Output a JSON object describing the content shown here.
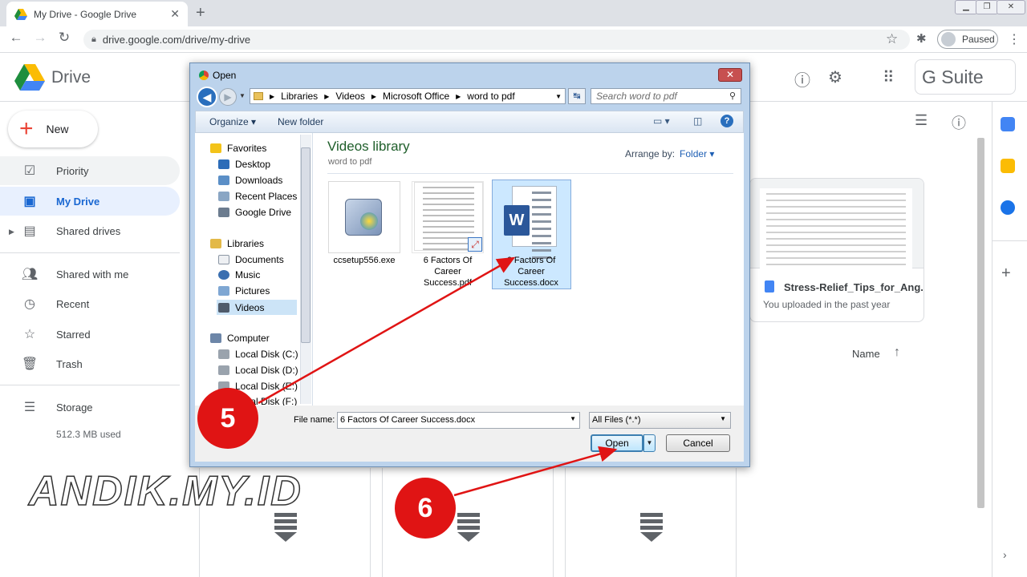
{
  "browser": {
    "tab_title": "My Drive - Google Drive",
    "tab_close": "✕",
    "new_tab": "+",
    "url": "drive.google.com/drive/my-drive",
    "profile_status": "Paused"
  },
  "drive": {
    "product_name": "Drive",
    "suite_label": "G Suite",
    "new_label": "New",
    "nav": [
      {
        "label": "Priority",
        "icon": "check-circle-icon"
      },
      {
        "label": "My Drive",
        "icon": "my-drive-icon"
      },
      {
        "label": "Shared drives",
        "icon": "shared-drives-icon"
      },
      {
        "label": "Shared with me",
        "icon": "people-icon"
      },
      {
        "label": "Recent",
        "icon": "clock-icon"
      },
      {
        "label": "Starred",
        "icon": "star-icon"
      },
      {
        "label": "Trash",
        "icon": "trash-icon"
      }
    ],
    "storage_label": "Storage",
    "storage_used": "512.3 MB used",
    "file_card": {
      "name": "Stress-Relief_Tips_for_Ang...",
      "subtitle": "You uploaded in the past year"
    },
    "sort_label": "Name"
  },
  "dialog": {
    "title": "Open",
    "breadcrumbs": [
      "Libraries",
      "Videos",
      "Microsoft Office",
      "word to pdf"
    ],
    "search_placeholder": "Search word to pdf",
    "organize_label": "Organize",
    "new_folder_label": "New folder",
    "nav_pane": {
      "favorites_label": "Favorites",
      "favorites": [
        "Desktop",
        "Downloads",
        "Recent Places",
        "Google Drive"
      ],
      "libraries_label": "Libraries",
      "libraries": [
        "Documents",
        "Music",
        "Pictures",
        "Videos"
      ],
      "computer_label": "Computer",
      "drives": [
        "Local Disk (C:)",
        "Local Disk (D:)",
        "Local Disk (E:)",
        "Local Disk (F:)"
      ]
    },
    "library_title": "Videos library",
    "library_subtitle": "word to pdf",
    "arrange_by_label": "Arrange by:",
    "arrange_by_value": "Folder",
    "files": [
      {
        "name": "ccsetup556.exe"
      },
      {
        "name": "6 Factors Of Career Success.pdf"
      },
      {
        "name": "6 Factors Of Career Success.docx"
      }
    ],
    "file_name_label": "File name:",
    "file_name_value": "6 Factors Of Career Success.docx",
    "file_type_value": "All Files (*.*)",
    "open_label": "Open",
    "cancel_label": "Cancel"
  },
  "annotations": {
    "step5": "5",
    "step6": "6",
    "watermark": "ANDIK.MY.ID",
    "arrow_color": "#e01414"
  }
}
